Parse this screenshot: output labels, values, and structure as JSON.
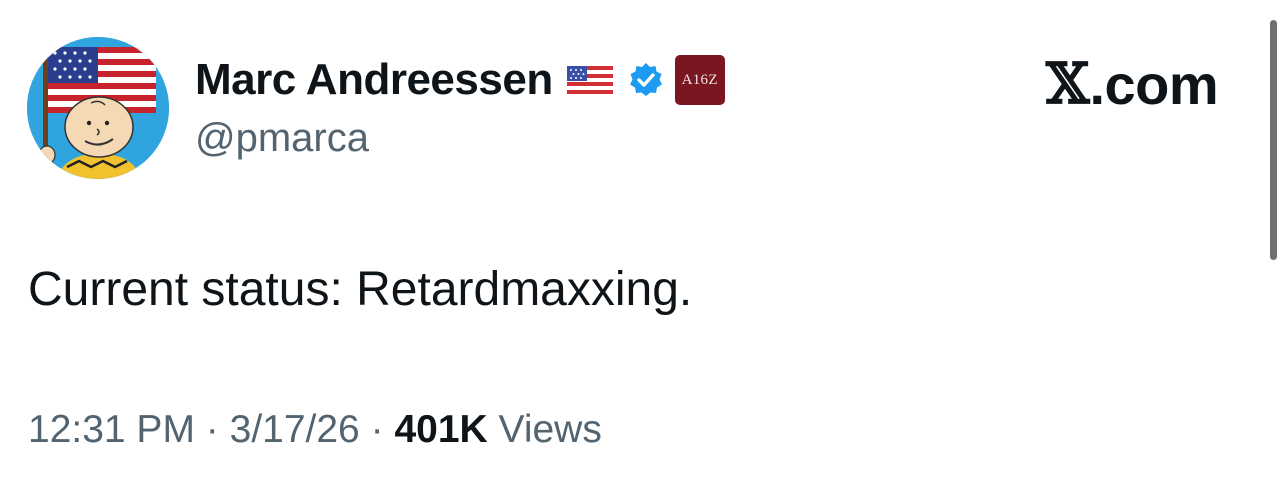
{
  "author": {
    "display_name": "Marc Andreessen",
    "handle": "@pmarca",
    "flag_icon": "us-flag-icon",
    "verified_icon": "verified-badge-icon",
    "affiliation_badge": "A16Z",
    "verified_color": "#1d9bf0",
    "badge_color": "#7a1621"
  },
  "site": {
    "domain": ".com",
    "logo_icon": "x-logo-icon"
  },
  "tweet": {
    "text": "Current status: Retardmaxxing.",
    "time": "12:31 PM",
    "separator": "·",
    "date": "3/17/26",
    "views_count": "401K",
    "views_label": "Views"
  },
  "colors": {
    "text_primary": "#0f1419",
    "text_secondary": "#536471"
  }
}
